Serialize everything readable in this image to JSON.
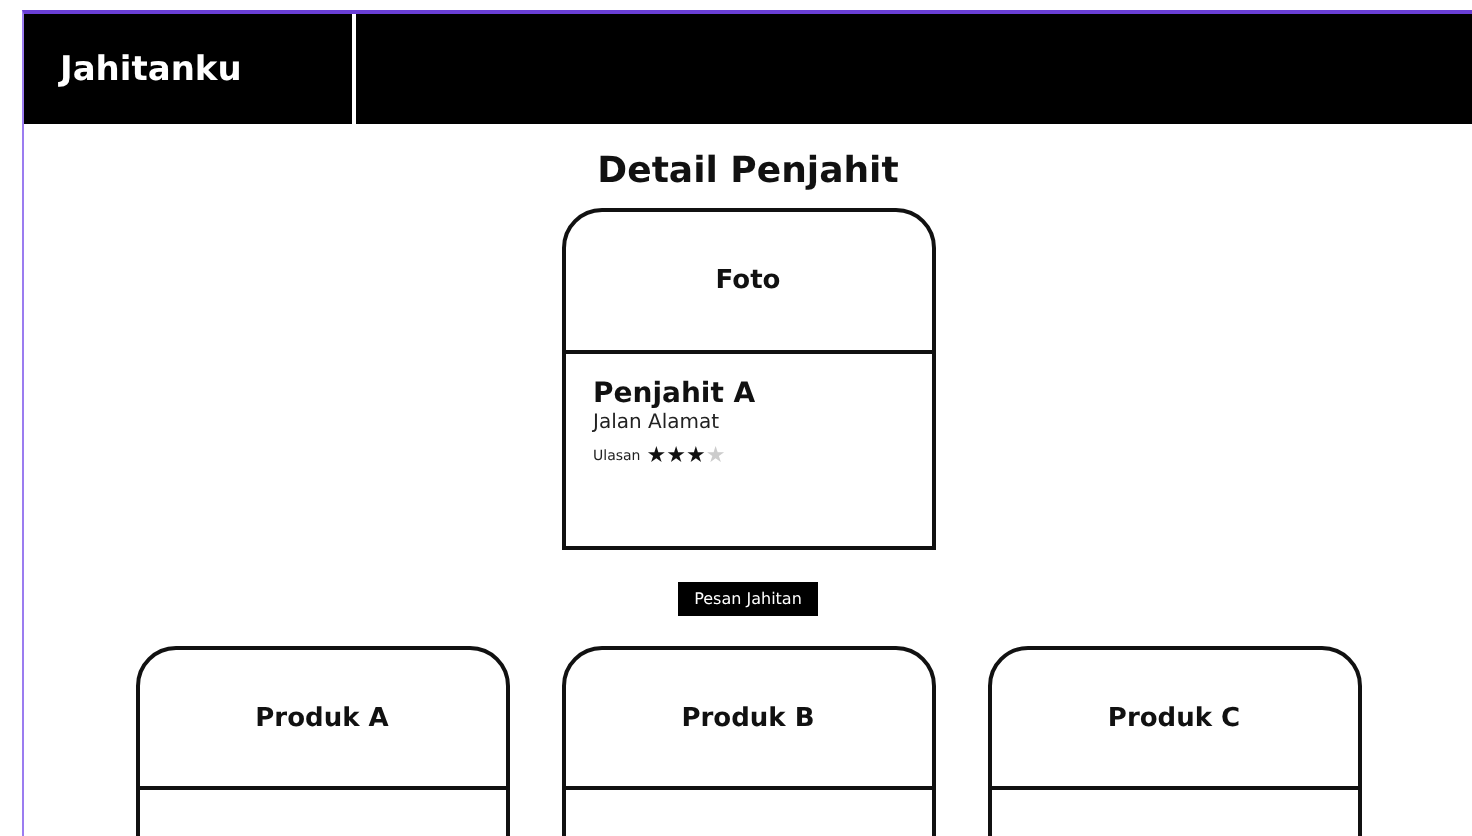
{
  "header": {
    "brand": "Jahitanku"
  },
  "page_title": "Detail Penjahit",
  "tailor": {
    "photo_label": "Foto",
    "name": "Penjahit A",
    "address": "Jalan Alamat",
    "rating_label": "Ulasan",
    "stars": 3
  },
  "order_button": "Pesan Jahitan",
  "products": [
    {
      "name": "Produk A"
    },
    {
      "name": "Produk B"
    },
    {
      "name": "Produk C"
    }
  ]
}
